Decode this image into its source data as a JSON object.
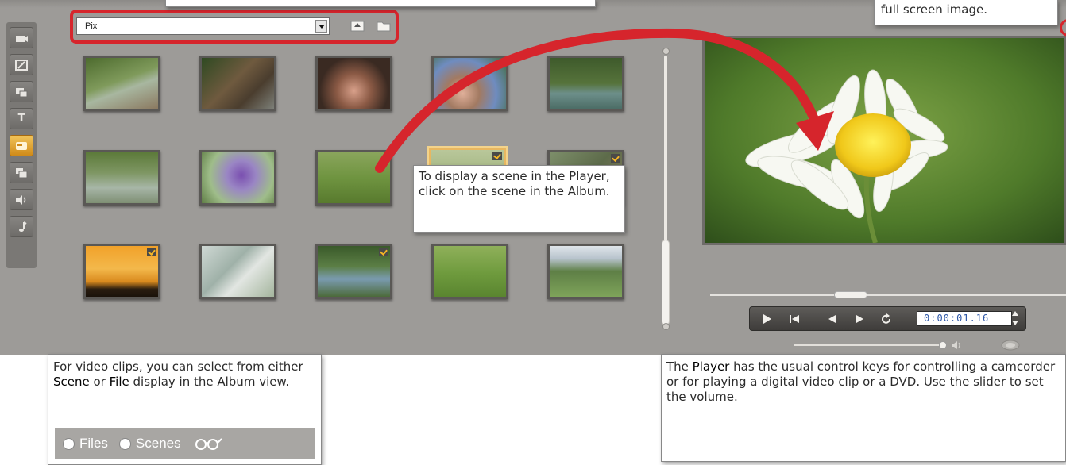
{
  "album": {
    "source_select_value": "Pix",
    "icons": [
      "up-folder-icon",
      "folder-icon"
    ]
  },
  "toolstrip": {
    "icons": [
      "video-clapper-icon",
      "transitions-icon",
      "still-images-icon",
      "titles-icon",
      "menus-icon",
      "effects-icon",
      "sound-effects-icon",
      "music-icon"
    ],
    "titles_glyph": "T",
    "active_index": 4
  },
  "thumbnails": [
    {
      "row": 1,
      "col": 1,
      "checked": false
    },
    {
      "row": 1,
      "col": 2,
      "checked": false
    },
    {
      "row": 1,
      "col": 3,
      "checked": false
    },
    {
      "row": 1,
      "col": 4,
      "checked": false
    },
    {
      "row": 1,
      "col": 5,
      "checked": false
    },
    {
      "row": 2,
      "col": 1,
      "checked": false
    },
    {
      "row": 2,
      "col": 2,
      "checked": false
    },
    {
      "row": 2,
      "col": 3,
      "checked": false
    },
    {
      "row": 2,
      "col": 4,
      "checked": true,
      "selected": true
    },
    {
      "row": 2,
      "col": 5,
      "checked": true
    },
    {
      "row": 3,
      "col": 1,
      "checked": true
    },
    {
      "row": 3,
      "col": 2,
      "checked": false
    },
    {
      "row": 3,
      "col": 3,
      "checked": true
    },
    {
      "row": 3,
      "col": 4,
      "checked": false
    },
    {
      "row": 3,
      "col": 5,
      "checked": false
    }
  ],
  "player": {
    "timecode": "0:00:01.16",
    "transport_icons": [
      "play-icon",
      "go-to-start-icon",
      "step-back-icon",
      "step-forward-icon",
      "loop-icon"
    ],
    "position_fraction": 0.39,
    "volume_fraction": 0.98
  },
  "callouts": {
    "scene_click": "To display a scene in the Player, click on the scene in the Album.",
    "full_screen": "full screen image.",
    "files_scenes": {
      "text_1": "For video clips, you can select from either ",
      "scene_word": "Scene",
      "text_2": " or ",
      "file_word": "File",
      "text_3": " display in the Album view.",
      "files_label": "Files",
      "scenes_label": "Scenes"
    },
    "player": {
      "text_1": "The ",
      "player_word": "Player",
      "text_2": " has the usual control keys for controlling a camcorder or for playing a digital video clip or a DVD. Use the slider to set the volume."
    }
  },
  "colors": {
    "highlight_red": "#d6252c",
    "app_gray": "#9d9b98",
    "active_tool_orange": "#e9a935",
    "timecode_blue": "#2f58a8"
  }
}
